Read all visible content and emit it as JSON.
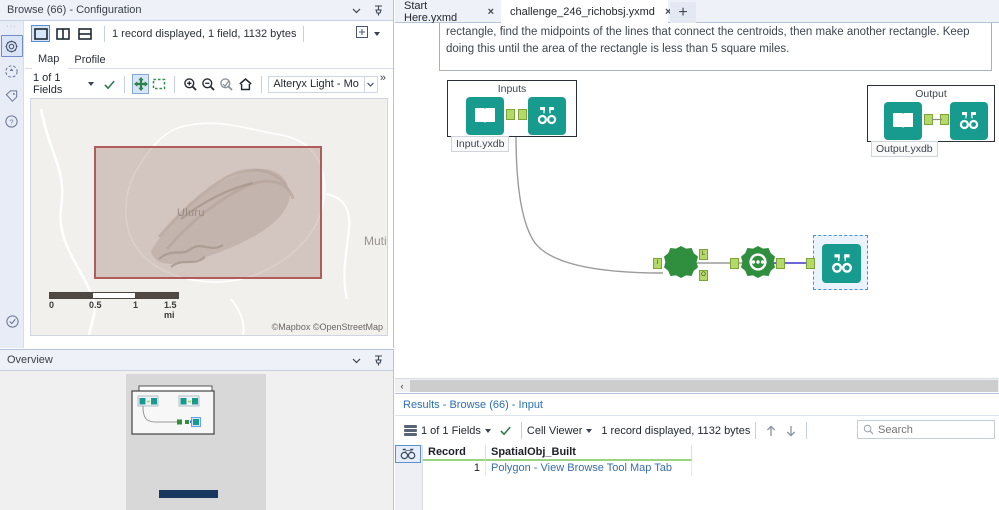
{
  "config_panel": {
    "title": "Browse (66) - Configuration",
    "rail_icons": [
      "gear-icon",
      "target-icon",
      "tag-icon",
      "help-icon"
    ],
    "rail_bottom_icon": "check-circle-icon",
    "view_buttons": [
      "single-view-icon",
      "split-vertical-icon",
      "split-horizontal-icon"
    ],
    "record_info": "1 record displayed, 1 field, 1132 bytes",
    "add_button": "add-column-icon",
    "tabs": [
      {
        "label": "Map",
        "active": true
      },
      {
        "label": "Profile",
        "active": false
      }
    ],
    "map_toolbar": {
      "fields_label": "1 of 1 Fields",
      "check_icon": "check-icon",
      "pan_icon": "pan-icon",
      "select_icon": "marquee-select-icon",
      "zoom_in_icon": "zoom-in-icon",
      "zoom_out_icon": "zoom-out-icon",
      "zoom_selection_icon": "zoom-to-selection-icon",
      "home_icon": "home-icon",
      "basemap": "Alteryx Light - Mo",
      "overflow": "»"
    },
    "map": {
      "place_label": "Uluru",
      "place_label_2": "Mutitj",
      "scale": {
        "ticks": [
          "0",
          "0.5",
          "1",
          "1.5 mi"
        ]
      },
      "attribution": "©Mapbox ©OpenStreetMap",
      "selection_color": "#b15b5b"
    }
  },
  "overview_panel": {
    "title": "Overview"
  },
  "workflow_tabs": [
    {
      "label": "Start Here.yxmd",
      "active": false,
      "close": "×"
    },
    {
      "label": "challenge_246_richobsj.yxmd",
      "active": true,
      "close": "×"
    }
  ],
  "tab_add_label": "+",
  "canvas": {
    "note": "rectangle, find the midpoints of the lines that connect the centroids, then make another rectangle. Keep doing this until the area of the rectangle is less than 5 square miles.",
    "containers": [
      {
        "caption": "Inputs",
        "file_label": "Input.yxdb"
      },
      {
        "caption": "Output",
        "file_label": "Output.yxdb"
      }
    ],
    "tools": [
      {
        "name": "input-data-tool",
        "icon": "book-icon"
      },
      {
        "name": "browse-tool",
        "icon": "binoculars-icon"
      },
      {
        "name": "macro-tool",
        "icon": "macro-gear-icon"
      },
      {
        "name": "iterative-macro-tool",
        "icon": "iterative-macro-icon"
      },
      {
        "name": "browse-tool-selected",
        "icon": "binoculars-icon"
      }
    ],
    "anchors": {
      "input": "I",
      "left": "L",
      "output": "O"
    },
    "scroll_left_arrow": "‹"
  },
  "results": {
    "title_prefix": "Results - ",
    "title": "Results - Browse (66) - Input",
    "toolbar": {
      "fields_label": "1 of 1 Fields",
      "check_icon": "check-icon",
      "viewer_label": "Cell Viewer",
      "record_info": "1 record displayed, 1132 bytes",
      "up_icon": "arrow-up-icon",
      "down_icon": "arrow-down-icon"
    },
    "search_placeholder": "Search",
    "table": {
      "row_icon": "binoculars-icon",
      "columns": [
        "Record",
        "SpatialObj_Built"
      ],
      "rows": [
        {
          "record": "1",
          "value": "Polygon - View Browse Tool Map Tab"
        }
      ]
    }
  }
}
